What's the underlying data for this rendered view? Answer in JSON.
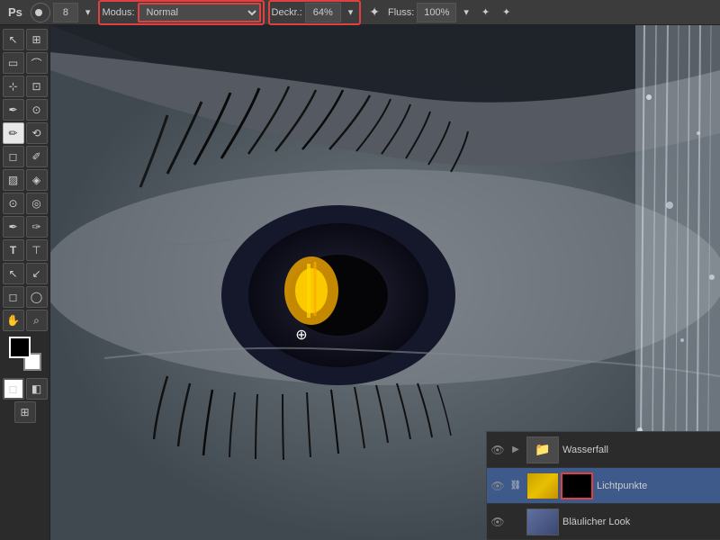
{
  "toolbar": {
    "title": "Adobe Photoshop",
    "brush_size_label": "8",
    "brush_size_icon": "▾",
    "modus_label": "Modus:",
    "modus_value": "Normal",
    "deckr_label": "Deckr.:",
    "deckr_value": "64%",
    "fluss_label": "Fluss:",
    "fluss_value": "100%",
    "airbrush_icon": "✦",
    "pen_pressure_icon": "✦"
  },
  "tools": [
    {
      "id": "marquee-rect",
      "icon": "▭",
      "active": false
    },
    {
      "id": "marquee-lasso",
      "icon": "⊹",
      "active": false
    },
    {
      "id": "crop",
      "icon": "⊡",
      "active": false
    },
    {
      "id": "eyedropper",
      "icon": "✒",
      "active": false
    },
    {
      "id": "brush",
      "icon": "✏",
      "active": true
    },
    {
      "id": "stamp",
      "icon": "✦",
      "active": false
    },
    {
      "id": "eraser",
      "icon": "◻",
      "active": false
    },
    {
      "id": "gradient",
      "icon": "▨",
      "active": false
    },
    {
      "id": "dodge",
      "icon": "⊙",
      "active": false
    },
    {
      "id": "pen",
      "icon": "✒",
      "active": false
    },
    {
      "id": "text",
      "icon": "T",
      "active": false
    },
    {
      "id": "path-select",
      "icon": "↖",
      "active": false
    },
    {
      "id": "shape",
      "icon": "◻",
      "active": false
    },
    {
      "id": "hand",
      "icon": "✋",
      "active": false
    },
    {
      "id": "zoom",
      "icon": "⌕",
      "active": false
    }
  ],
  "layers": [
    {
      "id": "wasserfall",
      "name": "Wasserfall",
      "type": "folder",
      "visible": true,
      "selected": false
    },
    {
      "id": "lichtpunkte",
      "name": "Lichtpunkte",
      "type": "layer",
      "visible": true,
      "selected": true,
      "has_link": true
    },
    {
      "id": "blaeulicher-look",
      "name": "Bläulicher Look",
      "type": "layer",
      "visible": true,
      "selected": false
    }
  ],
  "colors": {
    "foreground": "#000000",
    "background": "#ffffff",
    "accent_red": "#e04040",
    "layer_selected": "#3d5a8a"
  }
}
